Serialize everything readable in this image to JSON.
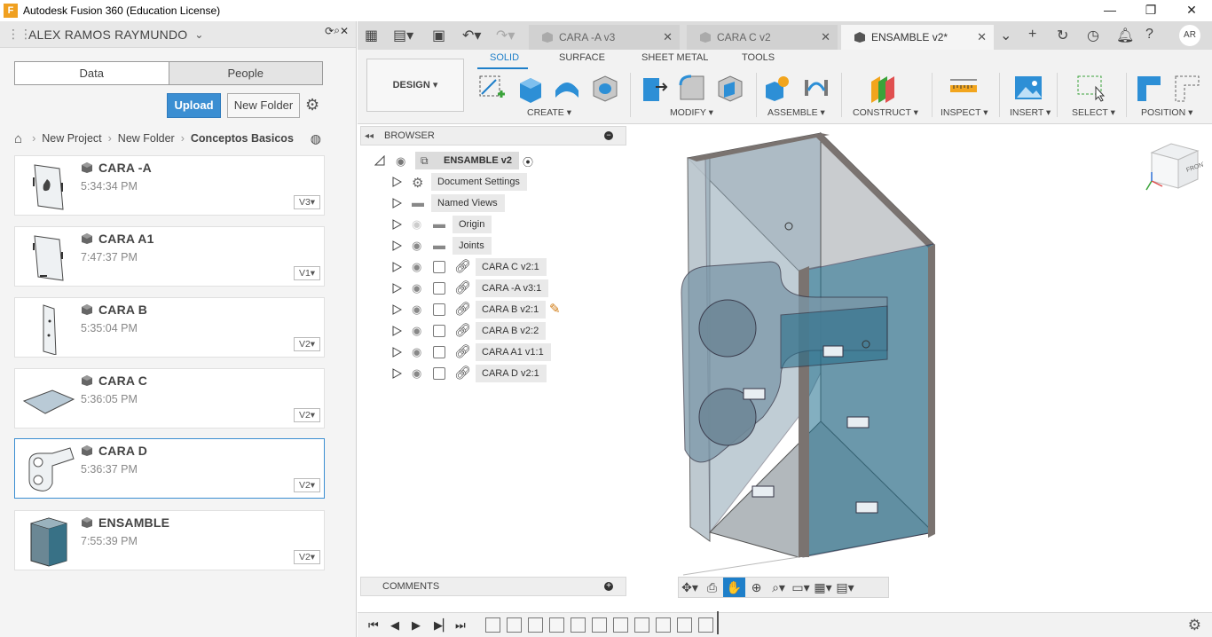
{
  "window": {
    "title": "Autodesk Fusion 360 (Education License)",
    "controls": [
      "—",
      "❐",
      "✕"
    ]
  },
  "data_panel": {
    "user": "ALEX RAMOS RAYMUNDO",
    "tabs": [
      "Data",
      "People"
    ],
    "upload_label": "Upload",
    "new_folder_label": "New Folder",
    "breadcrumb": [
      "New Project",
      "New Folder",
      "Conceptos Basicos"
    ],
    "files": [
      {
        "name": "CARA -A",
        "time": "5:34:34 PM",
        "version": "V3"
      },
      {
        "name": "CARA A1",
        "time": "7:47:37 PM",
        "version": "V1"
      },
      {
        "name": "CARA B",
        "time": "5:35:04 PM",
        "version": "V2"
      },
      {
        "name": "CARA C",
        "time": "5:36:05 PM",
        "version": "V2"
      },
      {
        "name": "CARA D",
        "time": "5:36:37 PM",
        "version": "V2"
      },
      {
        "name": "ENSAMBLE",
        "time": "7:55:39 PM",
        "version": "V2"
      }
    ]
  },
  "doc_tabs": [
    {
      "label": "CARA -A v3"
    },
    {
      "label": "CARA C v2"
    },
    {
      "label": "ENSAMBLE v2*"
    }
  ],
  "toolbar": {
    "workspace": "DESIGN",
    "ribbon_tabs": [
      "SOLID",
      "SURFACE",
      "SHEET METAL",
      "TOOLS"
    ],
    "groups": [
      "CREATE",
      "MODIFY",
      "ASSEMBLE",
      "CONSTRUCT",
      "INSPECT",
      "INSERT",
      "SELECT",
      "POSITION"
    ]
  },
  "browser": {
    "title": "BROWSER",
    "root": "ENSAMBLE v2",
    "items": [
      "Document Settings",
      "Named Views",
      "Origin",
      "Joints",
      "CARA C v2:1",
      "CARA -A v3:1",
      "CARA B v2:1",
      "CARA B v2:2",
      "CARA  A1 v1:1",
      "CARA D v2:1"
    ]
  },
  "comments": {
    "title": "COMMENTS"
  },
  "viewcube": {
    "face": "FRONT"
  },
  "colors": {
    "accent": "#1e7fc9",
    "upload": "#3b8ed2",
    "part_blue": "#2f7f9a"
  }
}
